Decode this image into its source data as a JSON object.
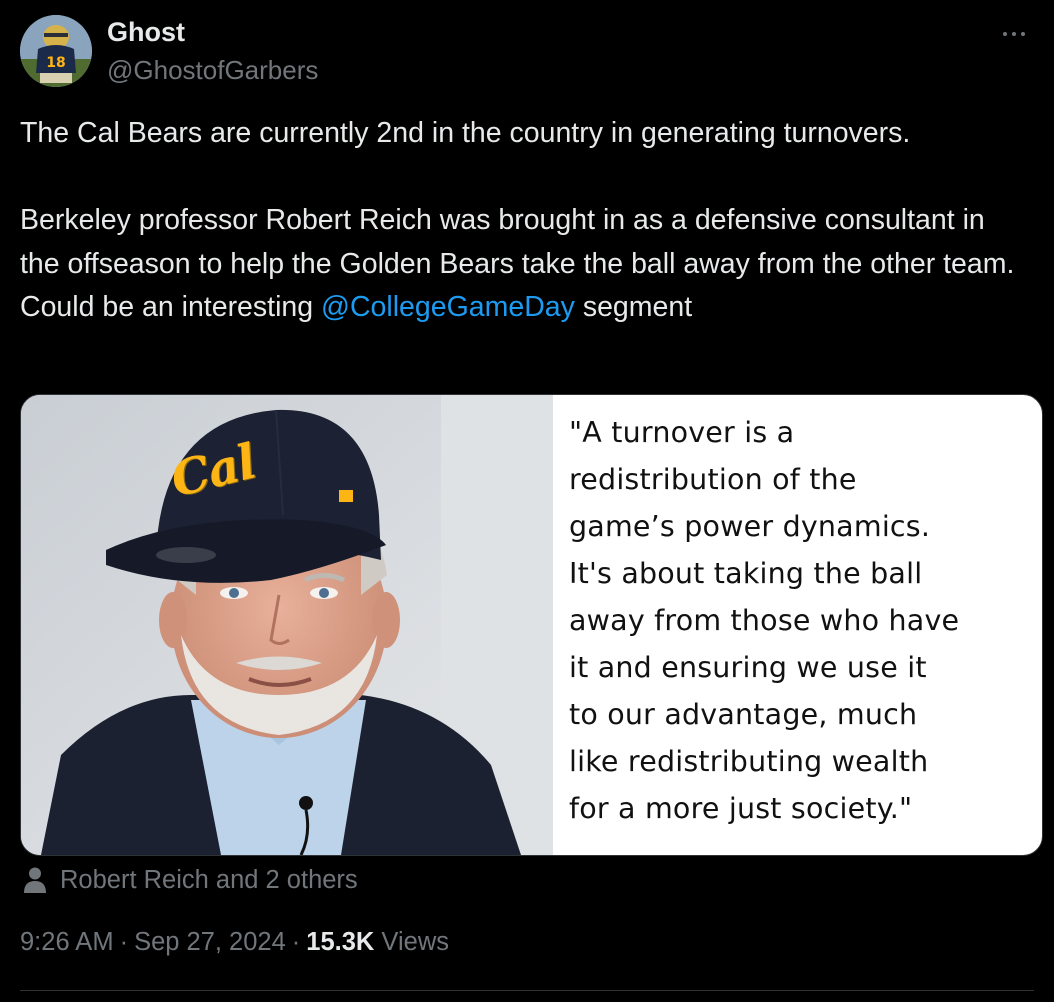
{
  "author": {
    "display_name": "Ghost",
    "handle": "@GhostofGarbers",
    "avatar_icon": "football-player-avatar"
  },
  "more_menu_icon": "more-horizontal-icon",
  "tweet": {
    "paragraph_1": "The Cal Bears are currently 2nd in the country in generating turnovers.",
    "paragraph_2_text": "Berkeley professor Robert Reich was brought in as a defensive consultant in the offseason to help the Golden Bears take the ball away from the other team. Could be an interesting ",
    "mention": "@CollegeGameDay",
    "paragraph_2_tail": " segment"
  },
  "media": {
    "hat_logo_text": "Cal",
    "quote_lines": [
      "\"A turnover is a",
      "redistribution of the",
      "game’s power dynamics.",
      "It's about taking the ball",
      "away from those who have",
      "it and ensuring we use it",
      "to our advantage, much",
      "like redistributing wealth",
      "for a more just society.\""
    ]
  },
  "tagged": {
    "icon": "person-icon",
    "label": "Robert Reich and 2 others"
  },
  "meta": {
    "time": "9:26 AM",
    "separator": "·",
    "date": "Sep 27, 2024",
    "views_count": "15.3K",
    "views_label": "Views"
  },
  "colors": {
    "background": "#000000",
    "text_primary": "#e7e9ea",
    "text_secondary": "#71767b",
    "link": "#1d9bf0",
    "cal_gold": "#fdb515",
    "cap_navy": "#1c2134"
  }
}
